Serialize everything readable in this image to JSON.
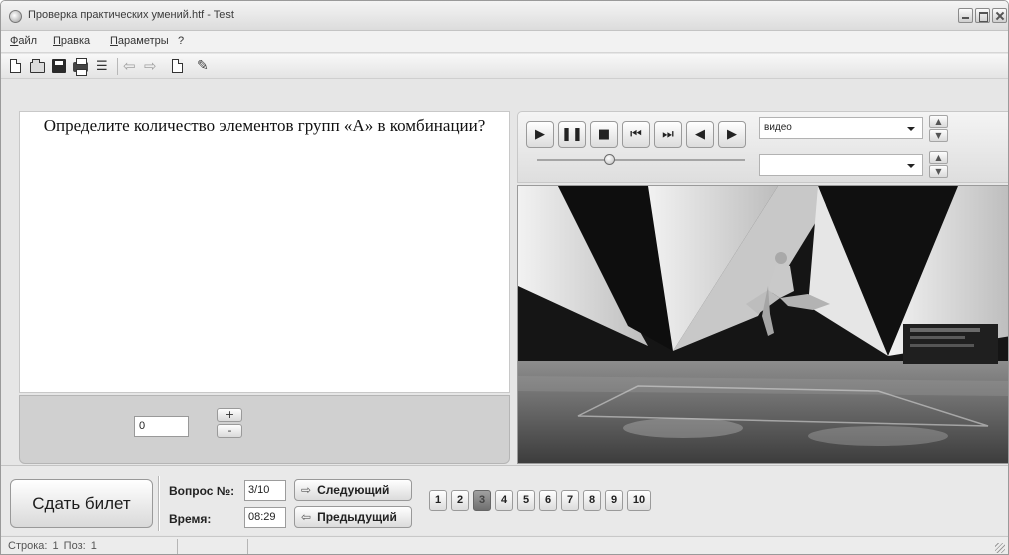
{
  "window": {
    "title": "Проверка практических умений.htf - Test"
  },
  "menu": {
    "items": [
      "Файл",
      "Правка",
      "Параметры",
      "?"
    ]
  },
  "question": {
    "text": "Определите количество элементов групп «А» в комбинации?"
  },
  "answer": {
    "value": "0",
    "spin_up": "+",
    "spin_down": "-"
  },
  "player": {
    "video_select": "видео",
    "secondary_select": "",
    "seek_progress": 0.35
  },
  "bottom": {
    "submit_label": "Сдать билет",
    "question_num_label": "Вопрос №:",
    "question_num_value": "3/10",
    "time_label": "Время:",
    "time_value": "08:29",
    "next_label": "Следующий",
    "prev_label": "Предыдущий",
    "pages": [
      "1",
      "2",
      "3",
      "4",
      "5",
      "6",
      "7",
      "8",
      "9",
      "10"
    ],
    "active_page": "3"
  },
  "status": {
    "text": "Строка: 1 Поз: 1"
  }
}
